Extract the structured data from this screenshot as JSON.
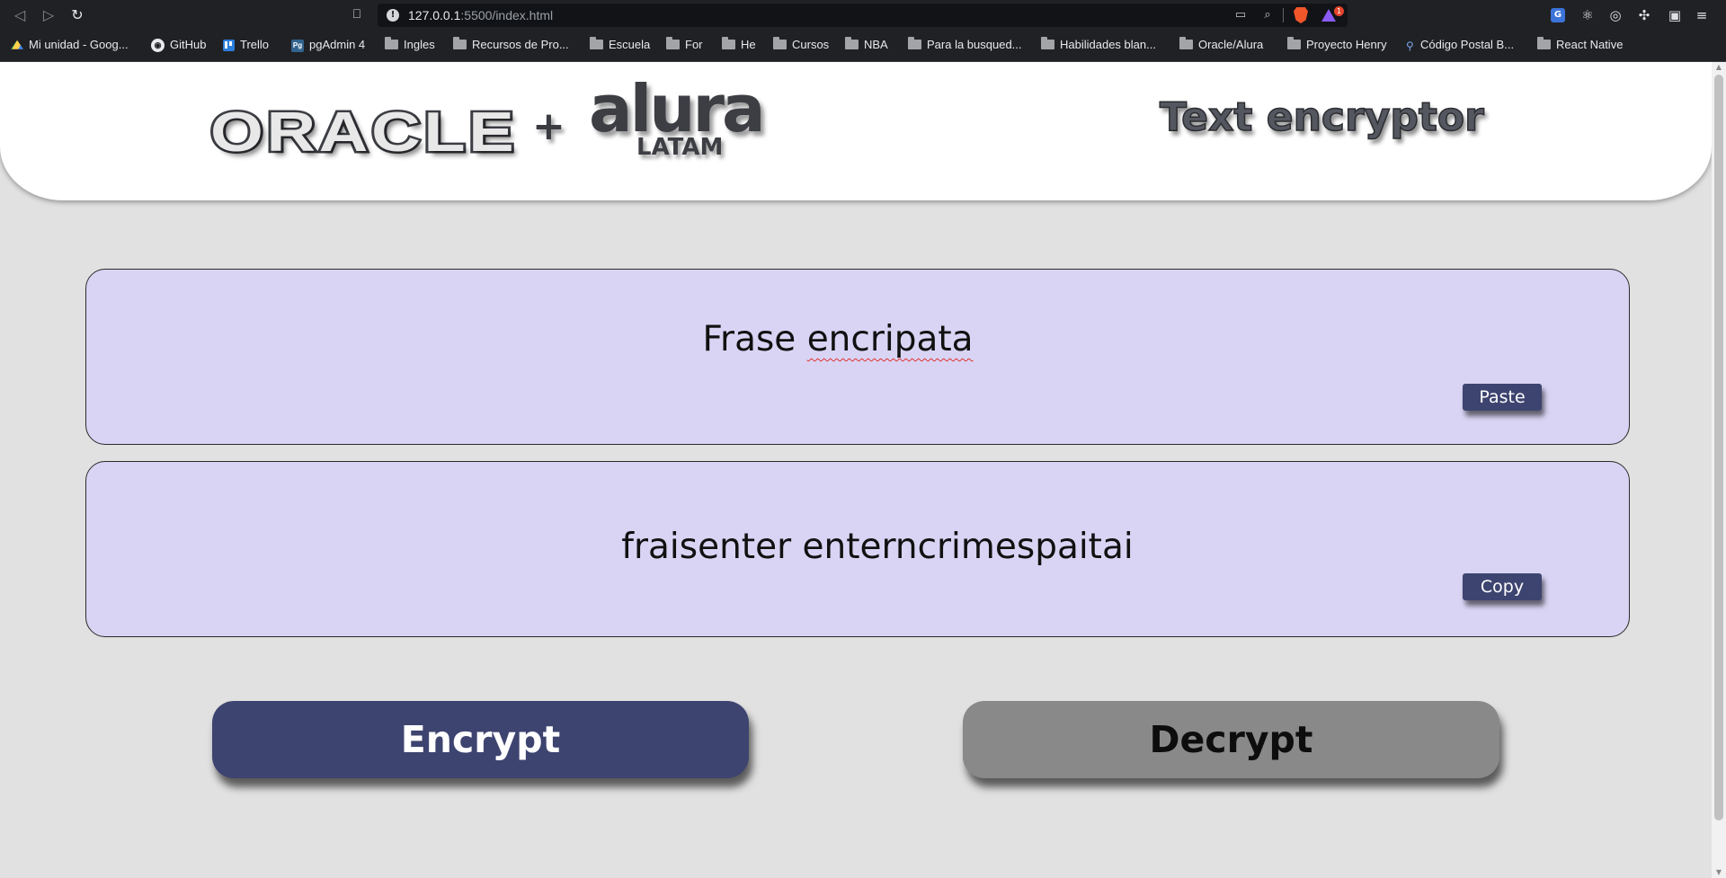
{
  "browser": {
    "url_host": "127.0.0.1",
    "url_rest": ":5500/index.html",
    "rewards_badge": "1",
    "bookmarks": [
      {
        "label": "Mi unidad - Goog...",
        "icon": "google-drive-icon"
      },
      {
        "label": "GitHub",
        "icon": "github-icon"
      },
      {
        "label": "Trello",
        "icon": "trello-icon"
      },
      {
        "label": "pgAdmin 4",
        "icon": "pgadmin-icon"
      },
      {
        "label": "Ingles",
        "icon": "folder-icon"
      },
      {
        "label": "Recursos de Pro...",
        "icon": "folder-icon"
      },
      {
        "label": "Escuela",
        "icon": "folder-icon"
      },
      {
        "label": "For",
        "icon": "folder-icon"
      },
      {
        "label": "He",
        "icon": "folder-icon"
      },
      {
        "label": "Cursos",
        "icon": "folder-icon"
      },
      {
        "label": "NBA",
        "icon": "folder-icon"
      },
      {
        "label": "Para la busqued...",
        "icon": "folder-icon"
      },
      {
        "label": "Habilidades blan...",
        "icon": "folder-icon"
      },
      {
        "label": "Oracle/Alura",
        "icon": "folder-icon"
      },
      {
        "label": "Proyecto Henry",
        "icon": "folder-icon"
      },
      {
        "label": "Código Postal B...",
        "icon": "map-pin-icon"
      },
      {
        "label": "React Native",
        "icon": "folder-icon"
      }
    ]
  },
  "header": {
    "oracle": "ORACLE",
    "plus": "+",
    "alura": "alura",
    "latam": "LATAM",
    "title": "Text encryptor"
  },
  "input_box": {
    "text_before": "Frase ",
    "text_misspelled": "encripata",
    "button": "Paste"
  },
  "output_box": {
    "text": "fraisenter enterncrimespaitai",
    "button": "Copy"
  },
  "actions": {
    "encrypt": "Encrypt",
    "decrypt": "Decrypt"
  },
  "colors": {
    "primary_button": "#3e4470",
    "secondary_button": "#898989",
    "text_box_bg": "#d9d4f4",
    "page_bg": "#e1e1e1"
  }
}
